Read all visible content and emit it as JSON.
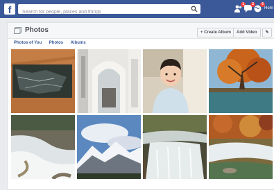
{
  "topbar": {
    "logo_letter": "f",
    "search_placeholder": "Search for people, places and things",
    "badges": {
      "friends": "1",
      "messages": "2",
      "notifications": "6"
    },
    "home_label": "Hom"
  },
  "photos_page": {
    "title": "Photos",
    "create_album_label": "+ Create Album",
    "add_video_label": "Add Video",
    "edit_label": "✎",
    "tabs": [
      "Photos of You",
      "Photos",
      "Albums"
    ]
  },
  "photo_grid": [
    {
      "subject": "stone tablet on wood"
    },
    {
      "subject": "white interior archway"
    },
    {
      "subject": "smiling toddler"
    },
    {
      "subject": "autumn tree over lake"
    },
    {
      "subject": "cascading river rapids"
    },
    {
      "subject": "snowy mountain peaks"
    },
    {
      "subject": "waterfall in forest"
    },
    {
      "subject": "autumn stream"
    }
  ],
  "colors": {
    "brand": "#3b5998",
    "link": "#365899",
    "badge": "#fa3e3e"
  }
}
